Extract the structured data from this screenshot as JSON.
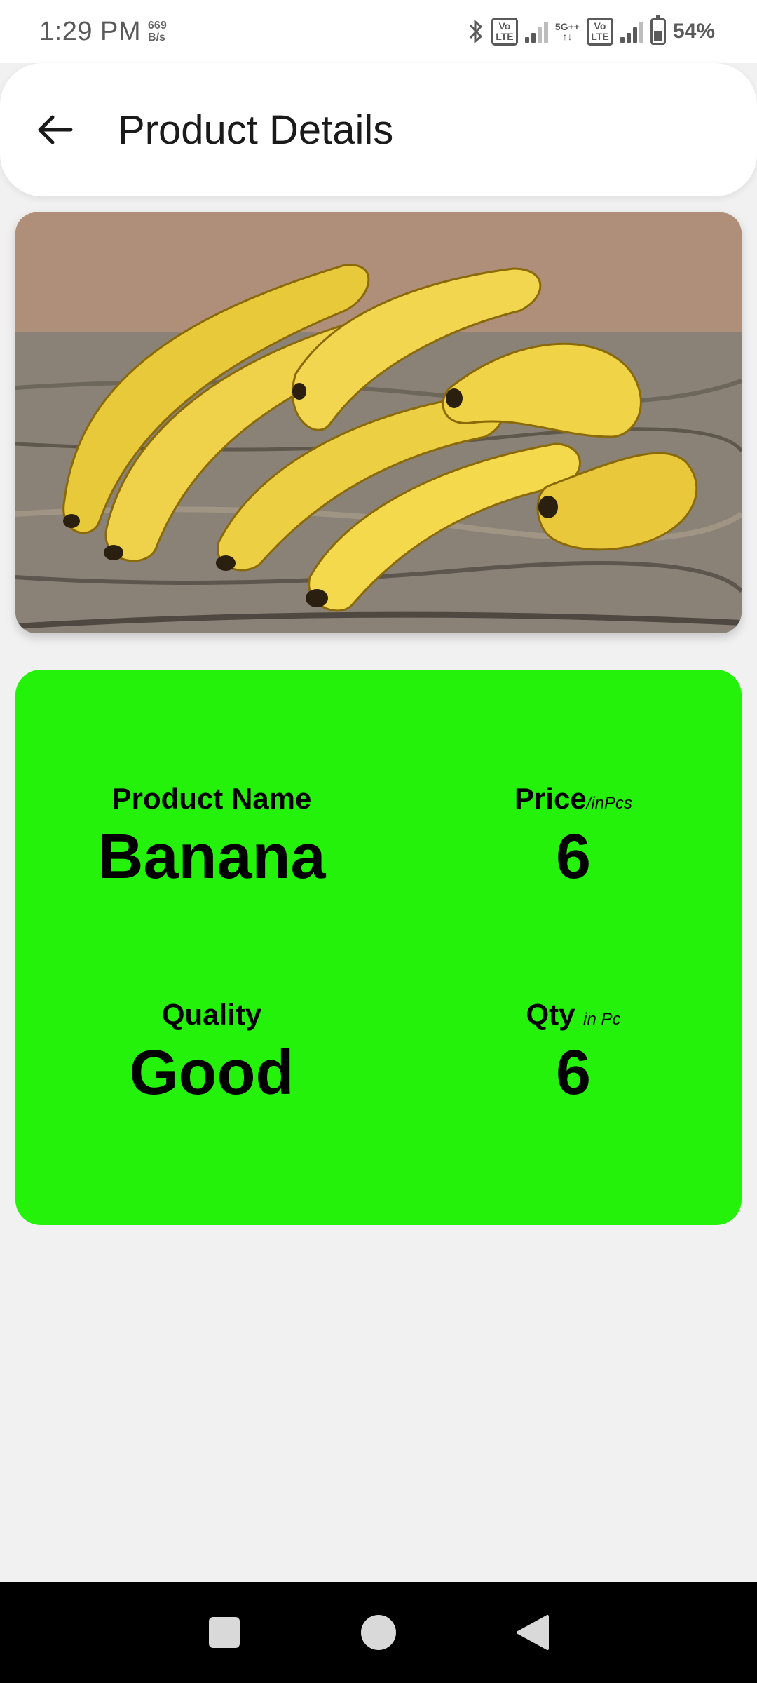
{
  "status_bar": {
    "time": "1:29 PM",
    "net_speed_value": "669",
    "net_speed_unit": "B/s",
    "volte_label": "Vo LTE",
    "network_label": "5G++",
    "battery": "54%",
    "battery_level": 0.54,
    "icons": [
      "bluetooth-icon",
      "volte-icon",
      "signal-icon",
      "5g-icon",
      "volte-icon",
      "signal-icon",
      "battery-icon"
    ]
  },
  "header": {
    "title": "Product Details",
    "back_icon": "arrow-left-icon"
  },
  "product": {
    "image_subject": "banana",
    "fields": {
      "name_label": "Product Name",
      "name_value": "Banana",
      "price_label": "Price",
      "price_unit": "/inPcs",
      "price_value": "6",
      "quality_label": "Quality",
      "quality_value": "Good",
      "qty_label": "Qty",
      "qty_unit": "in Pc",
      "qty_value": "6"
    },
    "card_color": "#24f20a"
  },
  "nav_bar": {
    "buttons": [
      "recents-square-icon",
      "home-circle-icon",
      "back-triangle-icon"
    ]
  }
}
